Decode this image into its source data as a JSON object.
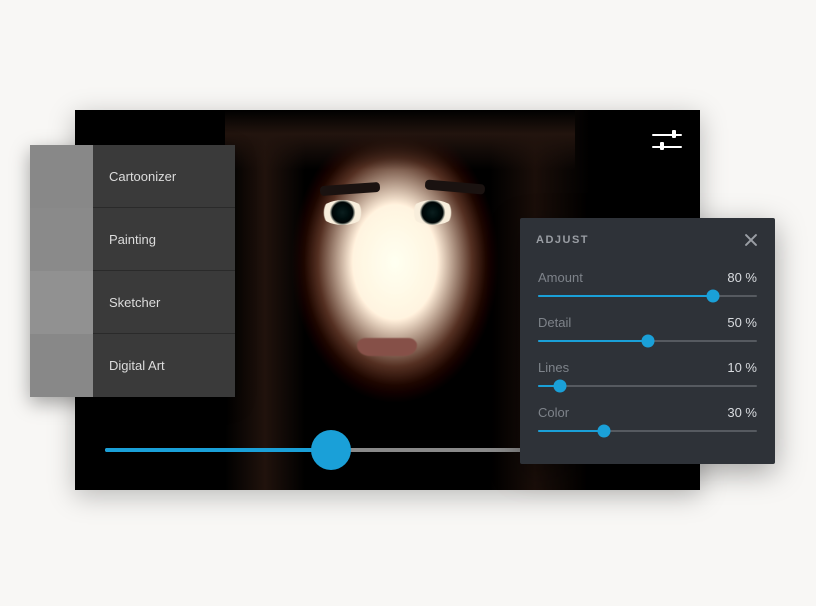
{
  "colors": {
    "accent": "#1aa0d8"
  },
  "canvas": {
    "main_slider_percent": 40
  },
  "filters": {
    "items": [
      {
        "label": "Cartoonizer",
        "thumb_class": "th-cartoon"
      },
      {
        "label": "Painting",
        "thumb_class": "th-paint"
      },
      {
        "label": "Sketcher",
        "thumb_class": "th-sketch"
      },
      {
        "label": "Digital Art",
        "thumb_class": "th-digital"
      }
    ]
  },
  "adjust": {
    "title": "ADJUST",
    "sliders": [
      {
        "label": "Amount",
        "value_text": "80 %",
        "percent": 80
      },
      {
        "label": "Detail",
        "value_text": "50 %",
        "percent": 50
      },
      {
        "label": "Lines",
        "value_text": "10 %",
        "percent": 10
      },
      {
        "label": "Color",
        "value_text": "30 %",
        "percent": 30
      }
    ]
  }
}
